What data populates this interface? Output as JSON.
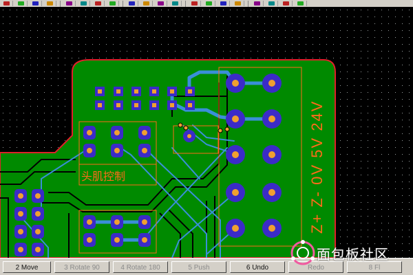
{
  "toolbar": {
    "icons": [
      "select-icon",
      "route-icon",
      "move-icon",
      "flip-icon",
      "rotate-icon",
      "zoom-icon",
      "pad-icon",
      "via-icon",
      "undo-icon",
      "redo-icon",
      "drc-icon",
      "fill-icon",
      "layer-icon",
      "grid-icon",
      "ratsnest-icon",
      "delete-icon",
      "text-icon",
      "measure-icon",
      "print-icon",
      "help-icon"
    ]
  },
  "board": {
    "silk_text_right": "Z+ Z- 0V 5V 24V",
    "silk_text_mid": "头肌控制",
    "silk_text_small": "",
    "colors": {
      "background": "#000000",
      "copper": "#008a00",
      "outline": "#e0202a",
      "trace": "#3a8fd8",
      "pad_ring": "#3b2bc8",
      "pad_center": "#f0a030",
      "silk": "#ff6b1a"
    }
  },
  "status": {
    "buttons": [
      {
        "label": "2 Move",
        "enabled": true
      },
      {
        "label": "3 Rotate 90",
        "enabled": false
      },
      {
        "label": "4 Rotate 180",
        "enabled": false
      },
      {
        "label": "5 Push",
        "enabled": false
      },
      {
        "label": "6 Undo",
        "enabled": true
      },
      {
        "label": "Redo",
        "enabled": false
      },
      {
        "label": "8 Fl",
        "enabled": false
      }
    ]
  },
  "watermark": {
    "text": "面包板社区"
  }
}
